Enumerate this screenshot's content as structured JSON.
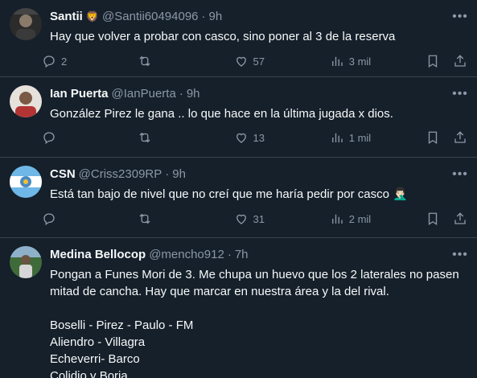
{
  "tweets": [
    {
      "display_name": "Santii",
      "name_emoji": "🦁",
      "handle": "@Santii60494096",
      "separator": "·",
      "time": "9h",
      "text": "Hay que volver a probar con casco, sino poner al 3 de la reserva",
      "replies": "2",
      "retweets": "",
      "likes": "57",
      "views": "3 mil"
    },
    {
      "display_name": "Ian Puerta",
      "name_emoji": "",
      "handle": "@IanPuerta",
      "separator": "·",
      "time": "9h",
      "text": "González Pirez le gana .. lo que hace en la última jugada x dios.",
      "replies": "",
      "retweets": "",
      "likes": "13",
      "views": "1 mil"
    },
    {
      "display_name": "CSN",
      "name_emoji": "",
      "handle": "@Criss2309RP",
      "separator": "·",
      "time": "9h",
      "text": "Está tan bajo de nivel que no creí que me haría pedir por casco 🤦🏻‍♂️",
      "replies": "",
      "retweets": "",
      "likes": "31",
      "views": "2 mil"
    },
    {
      "display_name": "Medina Bellocop",
      "name_emoji": "",
      "handle": "@mencho912",
      "separator": "·",
      "time": "7h",
      "text": "Pongan a Funes Mori de 3. Me chupa un huevo que los 2 laterales no pasen mitad de cancha. Hay que marcar en nuestra área y la del rival.\n\nBoselli - Pirez - Paulo - FM\nAliendro - Villagra\nEcheverri- Barco\nColidio y Borja."
    }
  ],
  "icons": {
    "reply": "reply-icon",
    "retweet": "retweet-icon",
    "like": "heart-icon",
    "views": "views-icon",
    "bookmark": "bookmark-icon",
    "share": "share-icon",
    "more": "more-icon"
  },
  "colors": {
    "background": "#15202b",
    "text": "#f7f9f9",
    "muted": "#8b98a5",
    "divider": "#38444d"
  }
}
